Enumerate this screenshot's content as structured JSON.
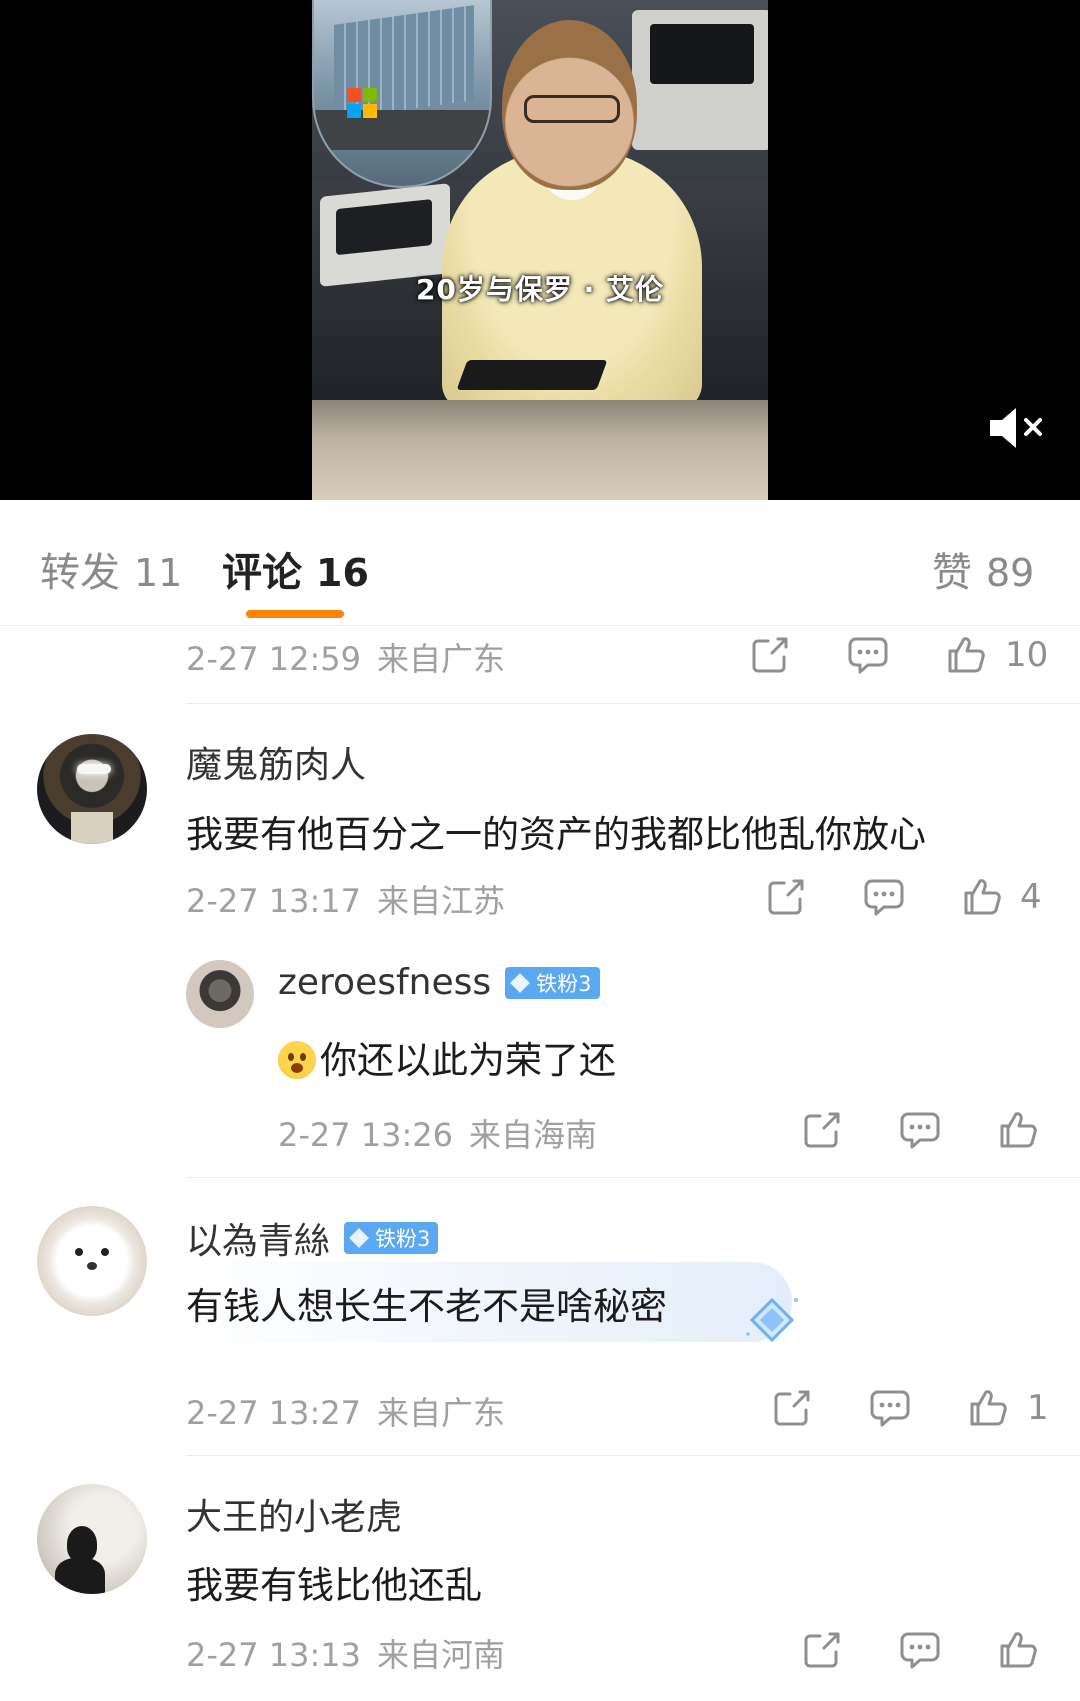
{
  "video": {
    "caption": "20岁与保罗 · 艾伦",
    "mute_icon": "speaker-muted-icon"
  },
  "tabs": {
    "repost": {
      "label": "转发",
      "count": "11"
    },
    "comment": {
      "label": "评论",
      "count": "16"
    },
    "like": {
      "label": "赞",
      "count": "89"
    },
    "accent": "#ff8200"
  },
  "comments": [
    {
      "time": "2-27 12:59",
      "location": "来自广东",
      "likes": "10"
    },
    {
      "user": "魔鬼筋肉人",
      "text": "我要有他百分之一的资产的我都比他乱你放心",
      "time": "2-27 13:17",
      "location": "来自江苏",
      "likes": "4",
      "reply": {
        "user": "zeroesfness",
        "badge": "铁粉3",
        "text": "你还以此为荣了还",
        "emoji": "scared-face-emoji",
        "time": "2-27 13:26",
        "location": "来自海南",
        "likes": ""
      }
    },
    {
      "user": "以為青絲",
      "badge": "铁粉3",
      "text": "有钱人想长生不老不是啥秘密",
      "time": "2-27 13:27",
      "location": "来自广东",
      "likes": "1"
    },
    {
      "user": "大王的小老虎",
      "text": "我要有钱比他还乱",
      "time": "2-27 13:13",
      "location": "来自河南",
      "likes": ""
    }
  ],
  "colors": {
    "badge": "#5aa7f2",
    "meta_text": "#a0a0a0"
  }
}
